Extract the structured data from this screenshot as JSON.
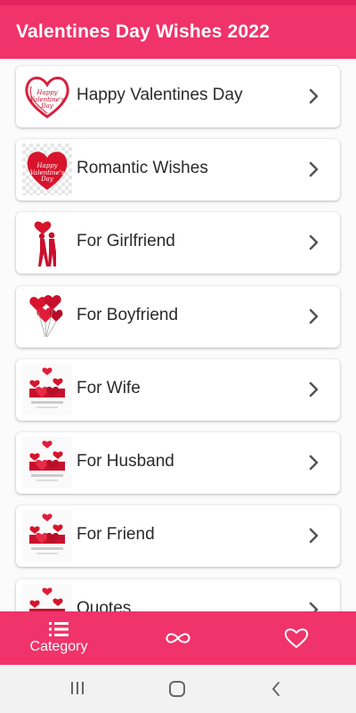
{
  "app_bar": {
    "title": "Valentines Day Wishes 2022"
  },
  "categories": [
    {
      "label": "Happy Valentines Day",
      "thumb_icon": "heart-outline-card-icon"
    },
    {
      "label": "Romantic Wishes",
      "thumb_icon": "heart-card-icon"
    },
    {
      "label": "For Girlfriend",
      "thumb_icon": "couple-silhouette-icon"
    },
    {
      "label": "For Boyfriend",
      "thumb_icon": "heart-balloons-icon"
    },
    {
      "label": "For Wife",
      "thumb_icon": "hearts-card-icon"
    },
    {
      "label": "For Husband",
      "thumb_icon": "hearts-card-icon"
    },
    {
      "label": "For Friend",
      "thumb_icon": "hearts-card-icon"
    },
    {
      "label": "Quotes",
      "thumb_icon": "hearts-card-icon"
    }
  ],
  "bottom_nav": {
    "category_label": "Category",
    "items": [
      "list-icon",
      "infinity-icon",
      "heart-outline-icon"
    ]
  },
  "colors": {
    "primary": "#f0336a",
    "status": "#e3225e",
    "chevron": "#555555"
  }
}
